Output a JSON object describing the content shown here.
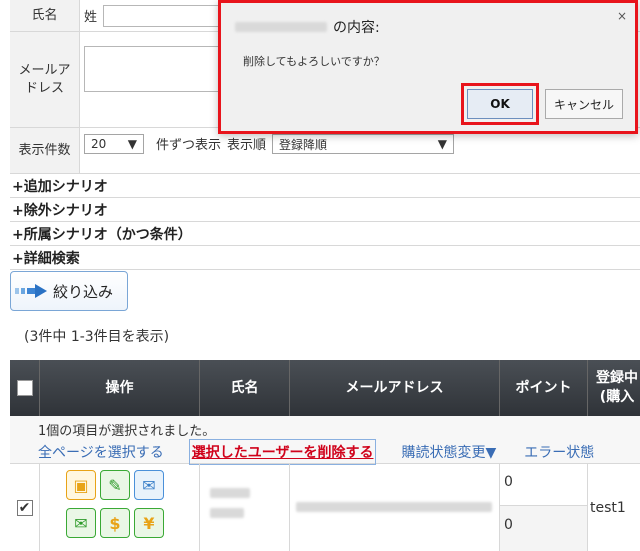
{
  "form": {
    "name_label": "氏名",
    "name_sei": "姓",
    "email_label_line1": "メールア",
    "email_label_line2": "ドレス",
    "display_count_label": "表示件数",
    "per_page_value": "20",
    "per_page_suffix": "件ずつ表示",
    "sort_label": "表示順",
    "sort_value": "登録降順"
  },
  "toggles": [
    "+追加シナリオ",
    "+除外シナリオ",
    "+所属シナリオ（かつ条件）",
    "+詳細検索"
  ],
  "filter_button_label": "絞り込み",
  "result_count": "(3件中 1-3件目を表示)",
  "table": {
    "headers": {
      "ops": "操作",
      "name": "氏名",
      "email": "メールアドレス",
      "points": "ポイント",
      "registered_line1": "登録中",
      "registered_line2": "(購入"
    },
    "notice": "1個の項目が選択されました。",
    "select_all_pages": "全ページを選択する",
    "delete_selected": "選択したユーザーを削除する",
    "change_subscription": "購読状態変更▼",
    "error_status": "エラー状態",
    "row": {
      "points_top": "0",
      "points_bottom": "0",
      "registered": "test1"
    }
  },
  "dialog": {
    "title_suffix": "の内容:",
    "message": "削除してもよろしいですか？",
    "ok_label": "OK",
    "cancel_label": "キャンセル",
    "close_glyph": "×"
  },
  "colors": {
    "highlight": "#e8141c",
    "link": "#3a6db5",
    "header_bg": "#3a3f45"
  },
  "icons": [
    "checkbox-icon",
    "arrow-right-icon",
    "contact-card-icon",
    "pencil-icon",
    "mail-icon",
    "send-mail-icon",
    "dollar-icon",
    "yen-icon",
    "check-icon"
  ]
}
